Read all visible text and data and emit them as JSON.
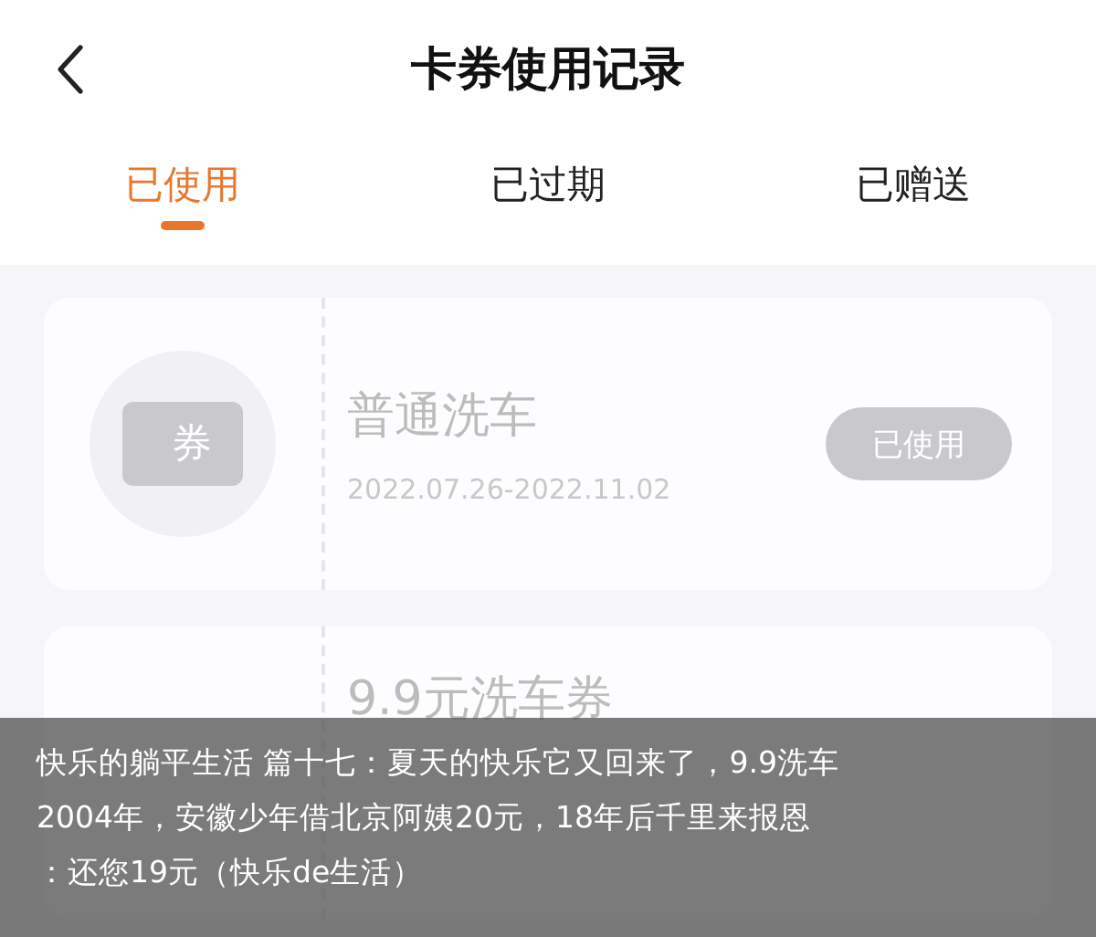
{
  "header": {
    "title": "卡券使用记录"
  },
  "tabs": [
    {
      "label": "已使用",
      "selected": true
    },
    {
      "label": "已过期",
      "selected": false
    },
    {
      "label": "已赠送",
      "selected": false
    }
  ],
  "coupons": [
    {
      "kind": "ticket",
      "icon_text": "券",
      "title": "普通洗车",
      "period": "2022.07.26-2022.11.02",
      "status": "已使用"
    },
    {
      "kind": "plain",
      "title": "9.9元洗车券"
    }
  ],
  "caption": {
    "lines": [
      "快乐的躺平生活 篇十七：夏天的快乐它又回来了，9.9洗车",
      "2004年，安徽少年借北京阿姨20元，18年后千里来报恩",
      "：还您19元（快乐de生活）"
    ]
  }
}
